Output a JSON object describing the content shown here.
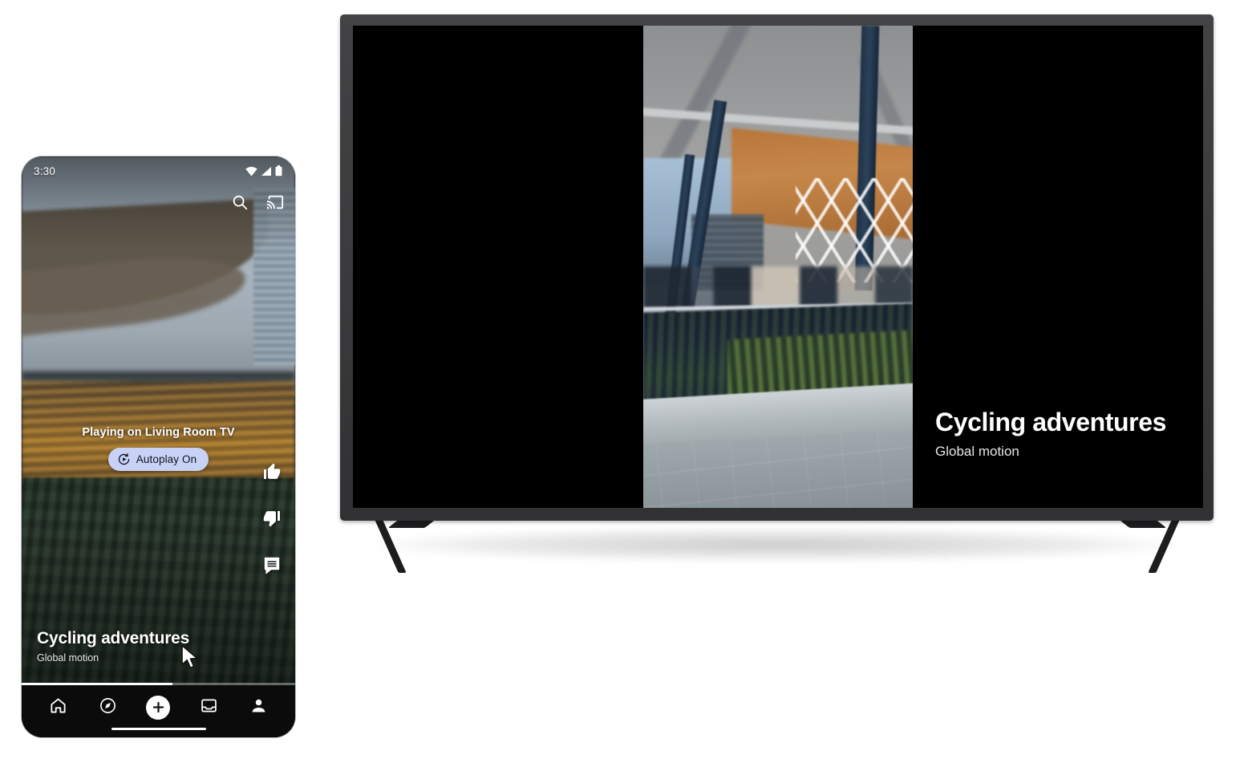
{
  "phone": {
    "status_bar": {
      "time": "3:30",
      "icons": [
        "wifi-icon",
        "signal-icon",
        "battery-icon"
      ]
    },
    "top_actions": [
      {
        "name": "search-icon",
        "label": "Search"
      },
      {
        "name": "cast-icon",
        "label": "Cast"
      }
    ],
    "cast_overlay": {
      "playing_on": "Playing on Living Room TV",
      "autoplay_label": "Autoplay On",
      "autoplay_icon": "autoplay-icon",
      "pill_color": "#c8d2f7"
    },
    "action_rail": [
      {
        "name": "thumbs-up-icon",
        "label": "Like"
      },
      {
        "name": "thumbs-down-icon",
        "label": "Dislike"
      },
      {
        "name": "comment-icon",
        "label": "Comments"
      }
    ],
    "meta": {
      "title": "Cycling adventures",
      "subtitle": "Global motion"
    },
    "progress_percent": 55,
    "bottom_nav": [
      {
        "name": "nav-home",
        "icon": "home-icon",
        "label": "Home"
      },
      {
        "name": "nav-explore",
        "icon": "compass-icon",
        "label": "Explore"
      },
      {
        "name": "nav-create",
        "icon": "plus-icon",
        "label": "Create"
      },
      {
        "name": "nav-inbox",
        "icon": "inbox-icon",
        "label": "Inbox"
      },
      {
        "name": "nav-profile",
        "icon": "person-icon",
        "label": "Profile"
      }
    ]
  },
  "tv": {
    "meta": {
      "title": "Cycling adventures",
      "subtitle": "Global motion"
    },
    "bezel_color": "#3a3a3c",
    "screen_background": "#000000"
  }
}
